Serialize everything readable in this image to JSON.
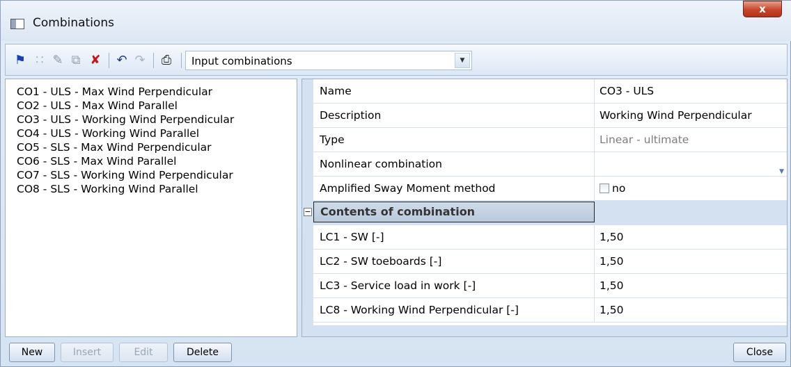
{
  "window": {
    "title": "Combinations",
    "close_glyph": "x"
  },
  "toolbar": {
    "icons": [
      "new-icon",
      "insert-icon",
      "edit-icon",
      "copy-icon",
      "delete-icon",
      "undo-icon",
      "redo-icon",
      "print-icon"
    ],
    "dropdown_value": "Input combinations"
  },
  "list": {
    "items": [
      "CO1 - ULS - Max Wind Perpendicular",
      "CO2 - ULS - Max Wind Parallel",
      "CO3 - ULS - Working Wind Perpendicular",
      "CO4 - ULS - Working Wind Parallel",
      "CO5 - SLS - Max Wind Perpendicular",
      "CO6 - SLS - Max Wind Parallel",
      "CO7 - SLS - Working Wind Perpendicular",
      "CO8 - SLS - Working Wind Parallel"
    ]
  },
  "properties": {
    "rows": [
      {
        "name": "Name",
        "value": "CO3 - ULS"
      },
      {
        "name": "Description",
        "value": "Working Wind Perpendicular"
      },
      {
        "name": "Type",
        "value": "Linear - ultimate"
      },
      {
        "name": "Nonlinear combination",
        "value": ""
      },
      {
        "name": "Amplified Sway Moment method",
        "value": "no"
      }
    ],
    "section_title": "Contents of combination",
    "load_cases": [
      {
        "name": "LC1 - SW [-]",
        "value": "1,50"
      },
      {
        "name": "LC2 - SW toeboards [-]",
        "value": "1,50"
      },
      {
        "name": "LC3 - Service load in work [-]",
        "value": "1,50"
      },
      {
        "name": "LC8 - Working Wind Perpendicular [-]",
        "value": "1,50"
      }
    ]
  },
  "buttons": {
    "new": "New",
    "insert": "Insert",
    "edit": "Edit",
    "delete": "Delete",
    "close": "Close"
  }
}
